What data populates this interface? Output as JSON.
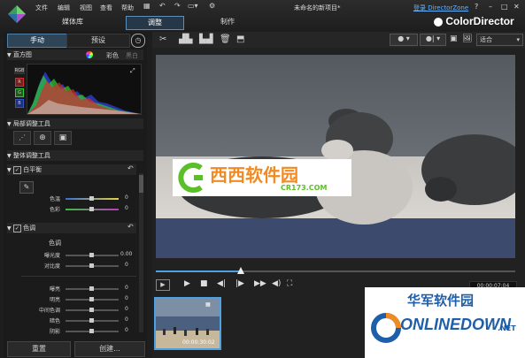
{
  "window": {
    "menu": [
      "文件",
      "编辑",
      "视图",
      "查看",
      "帮助"
    ],
    "title": "未命名的新项目*",
    "login": "登录 DirectorZone",
    "controls": [
      "?",
      "–",
      "□",
      "✕"
    ],
    "brand": "ColorDirector"
  },
  "mode_tabs": [
    "媒体库",
    "调整",
    "制作"
  ],
  "left_tabs": [
    "手动",
    "预设"
  ],
  "panels": {
    "histogram": {
      "label": "直方图",
      "color_label": "彩色",
      "bw_label": "黑白",
      "channels": [
        "RGB",
        "R",
        "G",
        "B"
      ]
    },
    "local_tools_label": "局部调整工具",
    "global_tools_label": "整体调整工具",
    "white_balance": {
      "label": "白平衡",
      "rows": [
        {
          "name": "色温",
          "value": "0"
        },
        {
          "name": "色彩",
          "value": "0"
        }
      ]
    },
    "tone": {
      "label": "色调",
      "subheading": "色调",
      "rows": [
        {
          "name": "曝光度",
          "value": "0.00"
        },
        {
          "name": "对比度",
          "value": "0"
        },
        {
          "name": "",
          "value": ""
        },
        {
          "name": "曝亮",
          "value": "0"
        },
        {
          "name": "明亮",
          "value": "0"
        },
        {
          "name": "中间色调",
          "value": "0"
        },
        {
          "name": "暗色",
          "value": "0"
        },
        {
          "name": "阴影",
          "value": "0"
        }
      ]
    }
  },
  "bottom_buttons": [
    "重置",
    "创建..."
  ],
  "view_toolbar": {
    "fit_label": "适合"
  },
  "timecode": "00:00:07:04",
  "thumbnail_time": "00:00:30:02",
  "watermarks": {
    "center_top": "西西软件园",
    "center_sub": "CR173.COM",
    "corner_top": "华军软件园",
    "corner_main": "ONLINEDOWN",
    "corner_suffix": ".NET"
  },
  "colors": {
    "accent": "#5d8fb8",
    "dark": "#1b1b1b",
    "watermark_green": "#5bbf2a",
    "watermark_orange": "#f08a24",
    "onlinedown_blue": "#1f5ea8"
  }
}
